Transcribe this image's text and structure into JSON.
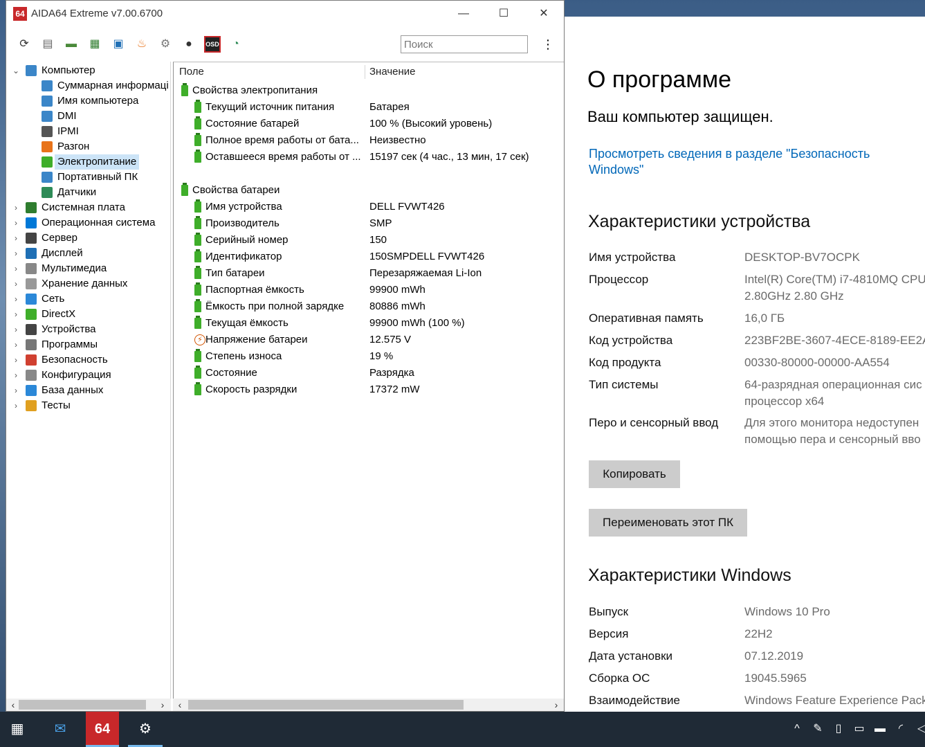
{
  "aida": {
    "title": "AIDA64 Extreme v7.00.6700",
    "app_icon_text": "64",
    "window_controls": {
      "minimize": "—",
      "maximize": "☐",
      "close": "✕"
    },
    "toolbar": {
      "buttons": [
        {
          "name": "refresh-icon",
          "glyph": "⟳",
          "color": "#333"
        },
        {
          "name": "report-icon",
          "glyph": "▤",
          "color": "#666"
        },
        {
          "name": "motherboard-icon",
          "glyph": "▬",
          "color": "#4a8a3a"
        },
        {
          "name": "memory-icon",
          "glyph": "▦",
          "color": "#2f7d2f"
        },
        {
          "name": "network-icon",
          "glyph": "▣",
          "color": "#1f6fb5"
        },
        {
          "name": "flame-icon",
          "glyph": "♨",
          "color": "#e8731a"
        },
        {
          "name": "tools-icon",
          "glyph": "⚙",
          "color": "#777"
        },
        {
          "name": "user-icon",
          "glyph": "●",
          "color": "#333"
        },
        {
          "name": "osd-icon",
          "glyph": "OSD",
          "color": "#c8282a"
        },
        {
          "name": "sensor-gauge-icon",
          "glyph": "◔",
          "color": "#2e8b57"
        }
      ],
      "search_placeholder": "Поиск",
      "menu_glyph": "⋮"
    },
    "tree": [
      {
        "label": "Компьютер",
        "level": 0,
        "arrow": "⌄",
        "icon": "#3b86c8"
      },
      {
        "label": "Суммарная информаці",
        "level": 1,
        "icon": "#3b86c8"
      },
      {
        "label": "Имя компьютера",
        "level": 1,
        "icon": "#3b86c8"
      },
      {
        "label": "DMI",
        "level": 1,
        "icon": "#3b86c8"
      },
      {
        "label": "IPMI",
        "level": 1,
        "icon": "#555"
      },
      {
        "label": "Разгон",
        "level": 1,
        "icon": "#e8731a"
      },
      {
        "label": "Электропитание",
        "level": 1,
        "icon": "#3fae2a",
        "selected": true
      },
      {
        "label": "Портативный ПК",
        "level": 1,
        "icon": "#3b86c8"
      },
      {
        "label": "Датчики",
        "level": 1,
        "icon": "#2e8b57"
      },
      {
        "label": "Системная плата",
        "level": 0,
        "arrow": "›",
        "icon": "#2f7d2f"
      },
      {
        "label": "Операционная система",
        "level": 0,
        "arrow": "›",
        "icon": "#0078d7"
      },
      {
        "label": "Сервер",
        "level": 0,
        "arrow": "›",
        "icon": "#444"
      },
      {
        "label": "Дисплей",
        "level": 0,
        "arrow": "›",
        "icon": "#1f6fb5"
      },
      {
        "label": "Мультимедиа",
        "level": 0,
        "arrow": "›",
        "icon": "#888"
      },
      {
        "label": "Хранение данных",
        "level": 0,
        "arrow": "›",
        "icon": "#999"
      },
      {
        "label": "Сеть",
        "level": 0,
        "arrow": "›",
        "icon": "#2b88d8"
      },
      {
        "label": "DirectX",
        "level": 0,
        "arrow": "›",
        "icon": "#3fae2a"
      },
      {
        "label": "Устройства",
        "level": 0,
        "arrow": "›",
        "icon": "#444"
      },
      {
        "label": "Программы",
        "level": 0,
        "arrow": "›",
        "icon": "#777"
      },
      {
        "label": "Безопасность",
        "level": 0,
        "arrow": "›",
        "icon": "#d04030"
      },
      {
        "label": "Конфигурация",
        "level": 0,
        "arrow": "›",
        "icon": "#888"
      },
      {
        "label": "База данных",
        "level": 0,
        "arrow": "›",
        "icon": "#2b88d8"
      },
      {
        "label": "Тесты",
        "level": 0,
        "arrow": "›",
        "icon": "#e0a020"
      }
    ],
    "grid": {
      "col_field": "Поле",
      "col_value": "Значение",
      "rows": [
        {
          "type": "group",
          "field": "Свойства электропитания"
        },
        {
          "type": "item",
          "field": "Текущий источник питания",
          "value": "Батарея"
        },
        {
          "type": "item",
          "field": "Состояние батарей",
          "value": "100 % (Высокий уровень)"
        },
        {
          "type": "item",
          "field": "Полное время работы от бата...",
          "value": "Неизвестно"
        },
        {
          "type": "item",
          "field": "Оставшееся время работы от ...",
          "value": "15197 сек (4 час., 13 мин, 17 сек)"
        },
        {
          "type": "blank"
        },
        {
          "type": "group",
          "field": "Свойства батареи"
        },
        {
          "type": "item",
          "field": "Имя устройства",
          "value": "DELL FVWT426"
        },
        {
          "type": "item",
          "field": "Производитель",
          "value": "SMP"
        },
        {
          "type": "item",
          "field": "Серийный номер",
          "value": "150"
        },
        {
          "type": "item",
          "field": "Идентификатор",
          "value": "150SMPDELL FVWT426"
        },
        {
          "type": "item",
          "field": "Тип батареи",
          "value": "Перезаряжаемая Li-Ion"
        },
        {
          "type": "item",
          "field": "Паспортная ёмкость",
          "value": "99900 mWh"
        },
        {
          "type": "item",
          "field": "Ёмкость при полной зарядке",
          "value": "80886 mWh"
        },
        {
          "type": "item",
          "field": "Текущая ёмкость",
          "value": "99900 mWh  (100 %)"
        },
        {
          "type": "item",
          "field": "Напряжение батареи",
          "value": "12.575 V",
          "icon": "bolt"
        },
        {
          "type": "item",
          "field": "Степень износа",
          "value": "19 %"
        },
        {
          "type": "item",
          "field": "Состояние",
          "value": "Разрядка"
        },
        {
          "type": "item",
          "field": "Скорость разрядки",
          "value": "17372 mW"
        }
      ]
    }
  },
  "settings": {
    "title": "О программе",
    "protected": "Ваш компьютер защищен.",
    "security_link_line1": "Просмотреть сведения в разделе \"Безопасность",
    "security_link_line2": "Windows\"",
    "device_specs_title": "Характеристики устройства",
    "device_specs": [
      {
        "k": "Имя устройства",
        "v": "DESKTOP-BV7OCPK"
      },
      {
        "k": "Процессор",
        "v": "Intel(R) Core(TM) i7-4810MQ CPU",
        "v2": "2.80GHz   2.80 GHz"
      },
      {
        "k": "Оперативная память",
        "v": "16,0 ГБ"
      },
      {
        "k": "Код устройства",
        "v": "223BF2BE-3607-4ECE-8189-EE2A8"
      },
      {
        "k": "Код продукта",
        "v": "00330-80000-00000-AA554"
      },
      {
        "k": "Тип системы",
        "v": "64-разрядная операционная сис",
        "v2": "процессор x64"
      },
      {
        "k": "Перо и сенсорный ввод",
        "v": "Для этого монитора недоступен",
        "v2": "помощью пера и сенсорный вво"
      }
    ],
    "copy_button": "Копировать",
    "rename_button": "Переименовать этот ПК",
    "windows_specs_title": "Характеристики Windows",
    "windows_specs": [
      {
        "k": "Выпуск",
        "v": "Windows 10 Pro"
      },
      {
        "k": "Версия",
        "v": "22H2"
      },
      {
        "k": "Дата установки",
        "v": "07.12.2019"
      },
      {
        "k": "Сборка ОС",
        "v": "19045.5965"
      },
      {
        "k": "Взаимодействие",
        "v": "Windows Feature Experience Pack"
      }
    ]
  },
  "taskbar": {
    "apps": [
      {
        "name": "store-icon",
        "glyph": "▦",
        "color": "#fff"
      },
      {
        "name": "outlook-icon",
        "glyph": "✉",
        "color": "#4aa0e6"
      },
      {
        "name": "aida64-taskbar-icon",
        "glyph": "64",
        "color": "#fff",
        "active": true
      },
      {
        "name": "settings-gear-icon",
        "glyph": "⚙",
        "color": "#fff",
        "active": true
      }
    ],
    "tray": [
      {
        "name": "tray-chevron-icon",
        "glyph": "^"
      },
      {
        "name": "pen-workspace-icon",
        "glyph": "✎"
      },
      {
        "name": "usb-icon",
        "glyph": "▯"
      },
      {
        "name": "meet-now-icon",
        "glyph": "▭"
      },
      {
        "name": "battery-icon",
        "glyph": "▬"
      },
      {
        "name": "wifi-icon",
        "glyph": "◜"
      },
      {
        "name": "volume-icon",
        "glyph": "◁"
      }
    ]
  }
}
